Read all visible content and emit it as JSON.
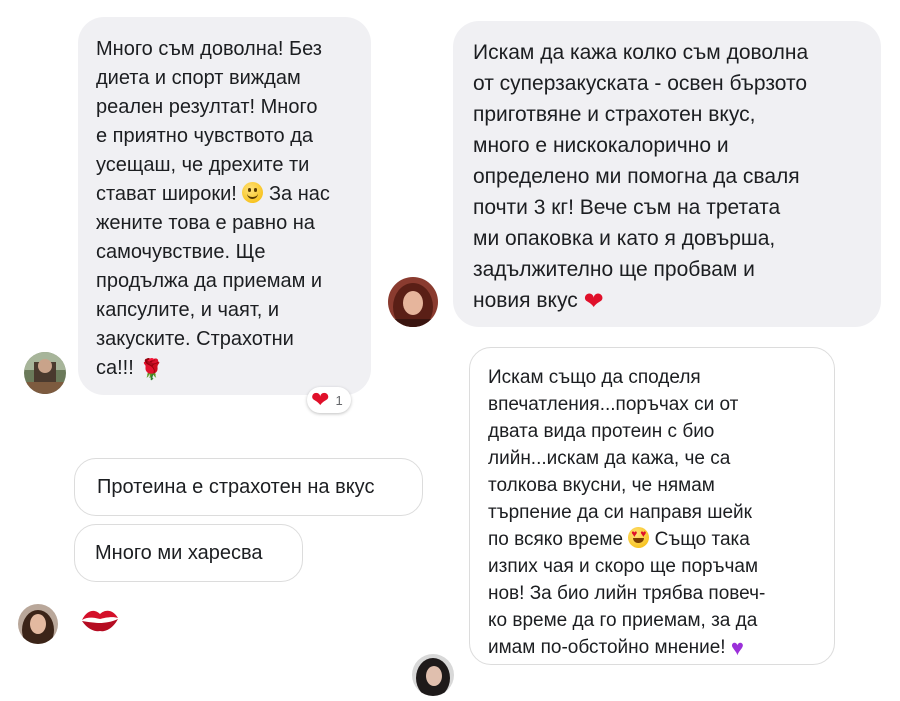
{
  "messages": {
    "m1": {
      "text": "Много съм доволна! Без\nдиета и спорт виждам\nреален резултат! Много\nе приятно чувството да\nусещаш, че дрехите ти\nстават широки!",
      "text_cont": "За нас\nжените това е равно на\nсамочувствие. Ще\nпродължа да приемам и\nкапсулите, и чаят, и\nзакуските. Страхотни\nса!!!"
    },
    "m1_reaction": {
      "emoji_name": "heart-icon",
      "count": "1"
    },
    "m2": {
      "text": "Искам да кажа колко съм доволна\nот суперзакуската - освен бързото\nприготвяне и страхотен вкус,\nмного е нискокалорично и\nопределено ми помогна да сваля\nпочти 3 кг! Вече съм на третата\nми опаковка и като я довърша,\nзадължително ще пробвам и\nновия вкус"
    },
    "m3": {
      "text": "Протеина е страхотен на вкус"
    },
    "m4": {
      "text": "Много ми харесва"
    },
    "m5": {
      "text": "Искам също да споделя\nвпечатления...поръчах си от\nдвата вида протеин с био\nлийн...искам да кажа, че са\nтолкова вкусни, че нямам\nтърпение да си направя шейк\nпо всяко време",
      "text_cont": "Също така\nизпих чая и скоро ще поръчам\nнов! За био лийн трябва повеч-\nко време да го приемам, за да\nимам по-обстойно мнение!"
    }
  },
  "colors": {
    "bubble_grey": "#f0f0f3",
    "heart_red": "#e0102a",
    "outline_border": "#dcdcdc"
  }
}
